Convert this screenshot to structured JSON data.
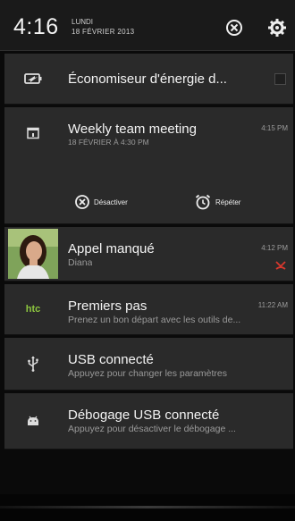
{
  "header": {
    "time": "4:16",
    "day": "LUNDI",
    "date": "18 FÉVRIER 2013"
  },
  "notifications": [
    {
      "icon": "battery-saver-icon",
      "title": "Économiseur d'énergie d..."
    },
    {
      "icon": "calendar-icon",
      "title": "Weekly team meeting",
      "subtitle": "18 FÉVRIER À 4:30 PM",
      "time": "4:15 PM",
      "actions": [
        {
          "icon": "dismiss-icon",
          "label": "Désactiver"
        },
        {
          "icon": "alarm-clock-icon",
          "label": "Répéter"
        }
      ]
    },
    {
      "icon": "contact-photo",
      "title": "Appel manqué",
      "subtitle": "Diana",
      "time": "4:12 PM"
    },
    {
      "icon": "htc-logo-icon",
      "icon_text": "htc",
      "title": "Premiers pas",
      "subtitle": "Prenez un bon départ avec les outils de...",
      "time": "11:22 AM"
    },
    {
      "icon": "usb-icon",
      "title": "USB connecté",
      "subtitle": "Appuyez pour changer les paramètres"
    },
    {
      "icon": "android-debug-icon",
      "title": "Débogage USB connecté",
      "subtitle": "Appuyez pour désactiver le débogage ..."
    }
  ],
  "colors": {
    "background": "#0a0a0a",
    "card": "#2a2a2a",
    "htc_green": "#8dc63f",
    "missed_call_red": "#d8382e"
  }
}
